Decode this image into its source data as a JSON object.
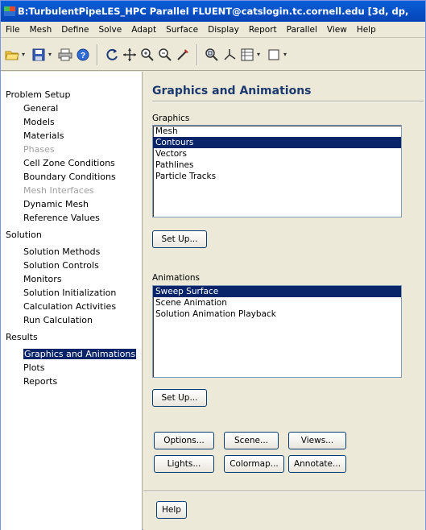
{
  "window": {
    "title": "B:TurbulentPipeLES_HPC Parallel FLUENT@catslogin.tc.cornell.edu [3d, dp,"
  },
  "menubar": {
    "items": [
      "File",
      "Mesh",
      "Define",
      "Solve",
      "Adapt",
      "Surface",
      "Display",
      "Report",
      "Parallel",
      "View",
      "Help"
    ]
  },
  "toolbar": {
    "icons": [
      "open-folder-icon",
      "save-icon",
      "print-icon",
      "help-icon",
      "rotate-icon",
      "pan-icon",
      "zoom-in-icon",
      "zoom-out-icon",
      "probe-icon",
      "zoom-box-icon",
      "axes-icon",
      "layout-icon",
      "window-icon"
    ]
  },
  "tree": {
    "sections": [
      {
        "label": "Problem Setup",
        "items": [
          {
            "label": "General",
            "state": "normal"
          },
          {
            "label": "Models",
            "state": "normal"
          },
          {
            "label": "Materials",
            "state": "normal"
          },
          {
            "label": "Phases",
            "state": "disabled"
          },
          {
            "label": "Cell Zone Conditions",
            "state": "normal"
          },
          {
            "label": "Boundary Conditions",
            "state": "normal"
          },
          {
            "label": "Mesh Interfaces",
            "state": "disabled"
          },
          {
            "label": "Dynamic Mesh",
            "state": "normal"
          },
          {
            "label": "Reference Values",
            "state": "normal"
          }
        ]
      },
      {
        "label": "Solution",
        "items": [
          {
            "label": "Solution Methods",
            "state": "normal"
          },
          {
            "label": "Solution Controls",
            "state": "normal"
          },
          {
            "label": "Monitors",
            "state": "normal"
          },
          {
            "label": "Solution Initialization",
            "state": "normal"
          },
          {
            "label": "Calculation Activities",
            "state": "normal"
          },
          {
            "label": "Run Calculation",
            "state": "normal"
          }
        ]
      },
      {
        "label": "Results",
        "items": [
          {
            "label": "Graphics and Animations",
            "state": "selected"
          },
          {
            "label": "Plots",
            "state": "normal"
          },
          {
            "label": "Reports",
            "state": "normal"
          }
        ]
      }
    ]
  },
  "panel": {
    "title": "Graphics and Animations",
    "graphics": {
      "label": "Graphics",
      "items": [
        "Mesh",
        "Contours",
        "Vectors",
        "Pathlines",
        "Particle Tracks"
      ],
      "selected": "Contours",
      "setup_label": "Set Up..."
    },
    "animations": {
      "label": "Animations",
      "items": [
        "Sweep Surface",
        "Scene Animation",
        "Solution Animation Playback"
      ],
      "selected": "Sweep Surface",
      "setup_label": "Set Up..."
    },
    "buttons": {
      "options": "Options...",
      "scene": "Scene...",
      "views": "Views...",
      "lights": "Lights...",
      "colormap": "Colormap...",
      "annotate": "Annotate...",
      "help": "Help"
    }
  }
}
